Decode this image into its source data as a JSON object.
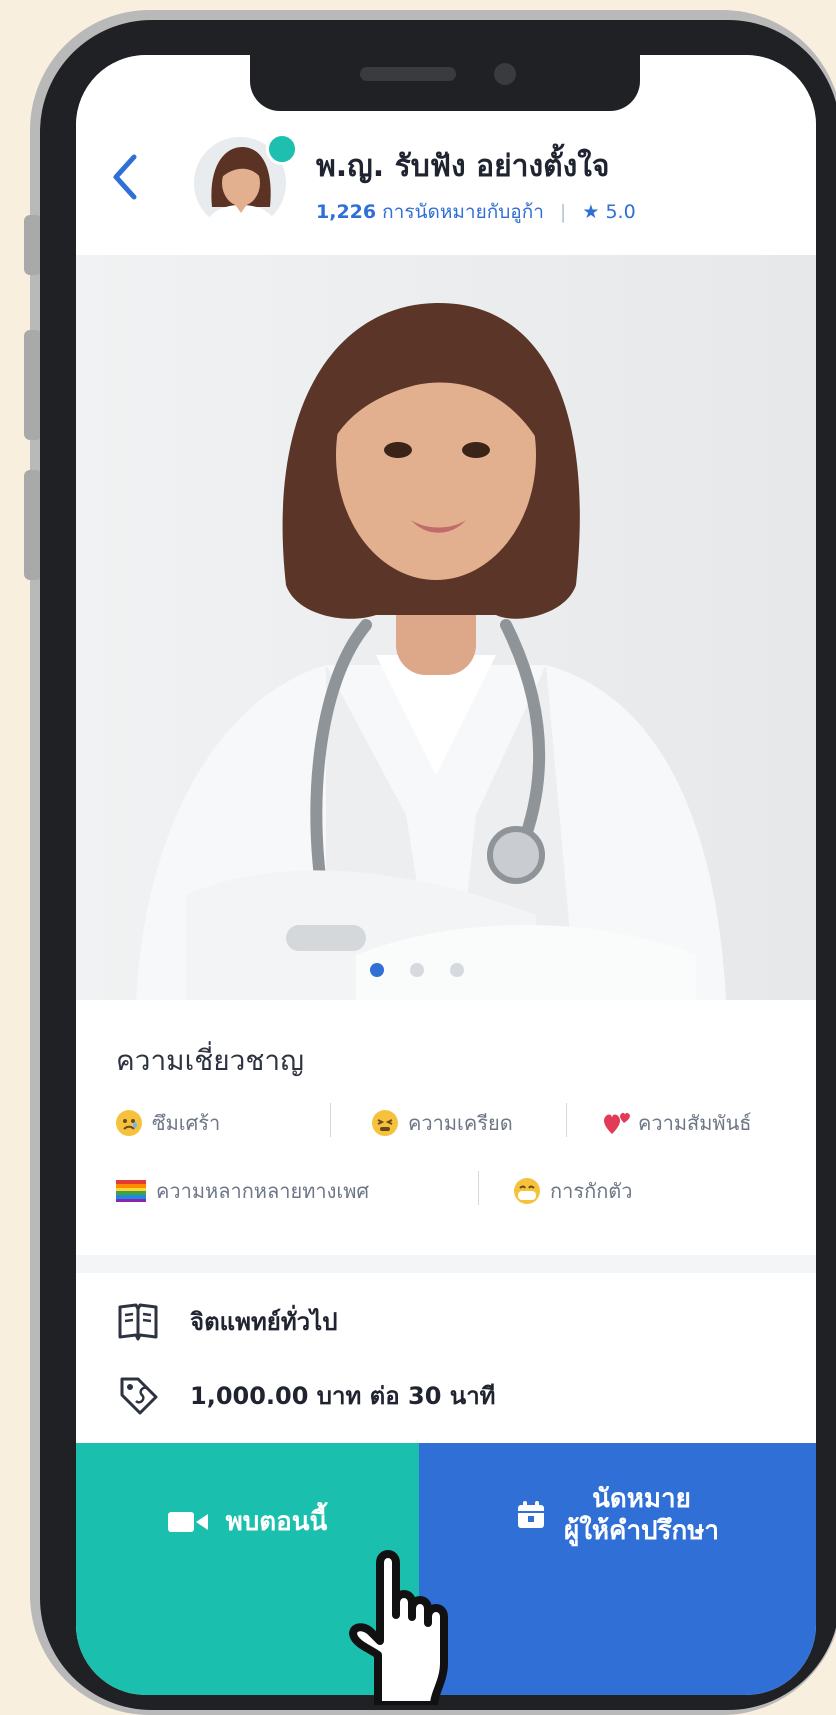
{
  "colors": {
    "background": "#f8efdf",
    "accent_blue": "#2f6fd6",
    "accent_teal": "#1bbfae",
    "online": "#1fbfb0"
  },
  "header": {
    "back_icon": "chevron-left-icon",
    "doctor_name": "พ.ญ. รับฟัง อย่างตั้งใจ",
    "appointments_count": "1,226",
    "appointments_label": "การนัดหมายกับอูก้า",
    "rating": "5.0",
    "rating_icon": "star-icon"
  },
  "photo": {
    "carousel": {
      "total": 3,
      "active_index": 0
    }
  },
  "specialty": {
    "title": "ความเชี่ยวชาญ",
    "tags": [
      {
        "label": "ซึมเศร้า",
        "icon": "sad-face-emoji"
      },
      {
        "label": "ความเครียด",
        "icon": "stressed-face-emoji"
      },
      {
        "label": "ความสัมพันธ์",
        "icon": "hearts-emoji"
      },
      {
        "label": "ความหลากหลายทางเพศ",
        "icon": "rainbow-flag-emoji"
      },
      {
        "label": "การกักตัว",
        "icon": "mask-face-emoji"
      }
    ]
  },
  "info": {
    "type": "จิตแพทย์ทั่วไป",
    "type_icon": "book-icon",
    "price": "1,000.00 บาท ต่อ 30 นาที",
    "price_icon": "price-tag-icon"
  },
  "actions": {
    "meet_now": "พบตอนนี้",
    "meet_now_icon": "video-camera-icon",
    "book_line1": "นัดหมาย",
    "book_line2": "ผู้ให้คำปรึกษา",
    "book_icon": "calendar-icon"
  }
}
